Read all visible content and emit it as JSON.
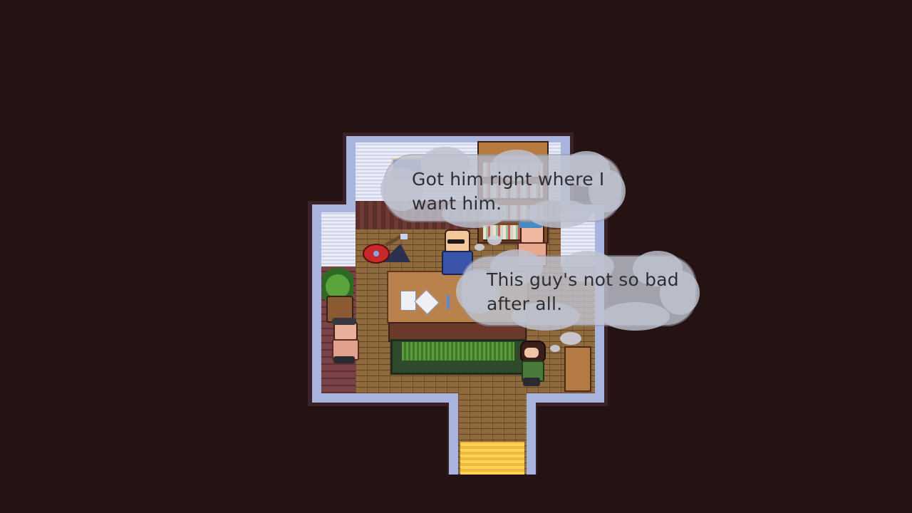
{
  "scene": {
    "background_color": "#251314",
    "wall_rim_color": "#a9b4de",
    "door_light_color": "#ffd35c"
  },
  "dialogue": {
    "bubble_1": {
      "line_1": "Got him right where I",
      "line_2": "want him."
    },
    "bubble_2": {
      "line_1": "This guy's not so bad",
      "line_2": "after all."
    }
  },
  "sprites": {
    "icons": [
      "bookshelf-icon",
      "picture-frame-icon",
      "guitar-icon",
      "potted-plant-icon",
      "table-icon",
      "rug-icon",
      "chair-icon",
      "paper-icon"
    ],
    "characters": [
      "bald-man-sunglasses",
      "bandana-man",
      "hat-man",
      "player-girl"
    ]
  }
}
